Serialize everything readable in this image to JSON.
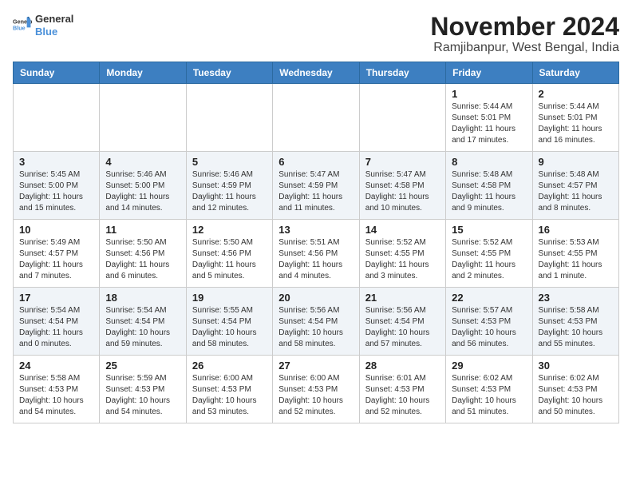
{
  "header": {
    "logo_general": "General",
    "logo_blue": "Blue",
    "month_title": "November 2024",
    "location": "Ramjibanpur, West Bengal, India"
  },
  "weekdays": [
    "Sunday",
    "Monday",
    "Tuesday",
    "Wednesday",
    "Thursday",
    "Friday",
    "Saturday"
  ],
  "weeks": [
    [
      {
        "day": "",
        "info": ""
      },
      {
        "day": "",
        "info": ""
      },
      {
        "day": "",
        "info": ""
      },
      {
        "day": "",
        "info": ""
      },
      {
        "day": "",
        "info": ""
      },
      {
        "day": "1",
        "info": "Sunrise: 5:44 AM\nSunset: 5:01 PM\nDaylight: 11 hours and 17 minutes."
      },
      {
        "day": "2",
        "info": "Sunrise: 5:44 AM\nSunset: 5:01 PM\nDaylight: 11 hours and 16 minutes."
      }
    ],
    [
      {
        "day": "3",
        "info": "Sunrise: 5:45 AM\nSunset: 5:00 PM\nDaylight: 11 hours and 15 minutes."
      },
      {
        "day": "4",
        "info": "Sunrise: 5:46 AM\nSunset: 5:00 PM\nDaylight: 11 hours and 14 minutes."
      },
      {
        "day": "5",
        "info": "Sunrise: 5:46 AM\nSunset: 4:59 PM\nDaylight: 11 hours and 12 minutes."
      },
      {
        "day": "6",
        "info": "Sunrise: 5:47 AM\nSunset: 4:59 PM\nDaylight: 11 hours and 11 minutes."
      },
      {
        "day": "7",
        "info": "Sunrise: 5:47 AM\nSunset: 4:58 PM\nDaylight: 11 hours and 10 minutes."
      },
      {
        "day": "8",
        "info": "Sunrise: 5:48 AM\nSunset: 4:58 PM\nDaylight: 11 hours and 9 minutes."
      },
      {
        "day": "9",
        "info": "Sunrise: 5:48 AM\nSunset: 4:57 PM\nDaylight: 11 hours and 8 minutes."
      }
    ],
    [
      {
        "day": "10",
        "info": "Sunrise: 5:49 AM\nSunset: 4:57 PM\nDaylight: 11 hours and 7 minutes."
      },
      {
        "day": "11",
        "info": "Sunrise: 5:50 AM\nSunset: 4:56 PM\nDaylight: 11 hours and 6 minutes."
      },
      {
        "day": "12",
        "info": "Sunrise: 5:50 AM\nSunset: 4:56 PM\nDaylight: 11 hours and 5 minutes."
      },
      {
        "day": "13",
        "info": "Sunrise: 5:51 AM\nSunset: 4:56 PM\nDaylight: 11 hours and 4 minutes."
      },
      {
        "day": "14",
        "info": "Sunrise: 5:52 AM\nSunset: 4:55 PM\nDaylight: 11 hours and 3 minutes."
      },
      {
        "day": "15",
        "info": "Sunrise: 5:52 AM\nSunset: 4:55 PM\nDaylight: 11 hours and 2 minutes."
      },
      {
        "day": "16",
        "info": "Sunrise: 5:53 AM\nSunset: 4:55 PM\nDaylight: 11 hours and 1 minute."
      }
    ],
    [
      {
        "day": "17",
        "info": "Sunrise: 5:54 AM\nSunset: 4:54 PM\nDaylight: 11 hours and 0 minutes."
      },
      {
        "day": "18",
        "info": "Sunrise: 5:54 AM\nSunset: 4:54 PM\nDaylight: 10 hours and 59 minutes."
      },
      {
        "day": "19",
        "info": "Sunrise: 5:55 AM\nSunset: 4:54 PM\nDaylight: 10 hours and 58 minutes."
      },
      {
        "day": "20",
        "info": "Sunrise: 5:56 AM\nSunset: 4:54 PM\nDaylight: 10 hours and 58 minutes."
      },
      {
        "day": "21",
        "info": "Sunrise: 5:56 AM\nSunset: 4:54 PM\nDaylight: 10 hours and 57 minutes."
      },
      {
        "day": "22",
        "info": "Sunrise: 5:57 AM\nSunset: 4:53 PM\nDaylight: 10 hours and 56 minutes."
      },
      {
        "day": "23",
        "info": "Sunrise: 5:58 AM\nSunset: 4:53 PM\nDaylight: 10 hours and 55 minutes."
      }
    ],
    [
      {
        "day": "24",
        "info": "Sunrise: 5:58 AM\nSunset: 4:53 PM\nDaylight: 10 hours and 54 minutes."
      },
      {
        "day": "25",
        "info": "Sunrise: 5:59 AM\nSunset: 4:53 PM\nDaylight: 10 hours and 54 minutes."
      },
      {
        "day": "26",
        "info": "Sunrise: 6:00 AM\nSunset: 4:53 PM\nDaylight: 10 hours and 53 minutes."
      },
      {
        "day": "27",
        "info": "Sunrise: 6:00 AM\nSunset: 4:53 PM\nDaylight: 10 hours and 52 minutes."
      },
      {
        "day": "28",
        "info": "Sunrise: 6:01 AM\nSunset: 4:53 PM\nDaylight: 10 hours and 52 minutes."
      },
      {
        "day": "29",
        "info": "Sunrise: 6:02 AM\nSunset: 4:53 PM\nDaylight: 10 hours and 51 minutes."
      },
      {
        "day": "30",
        "info": "Sunrise: 6:02 AM\nSunset: 4:53 PM\nDaylight: 10 hours and 50 minutes."
      }
    ]
  ]
}
